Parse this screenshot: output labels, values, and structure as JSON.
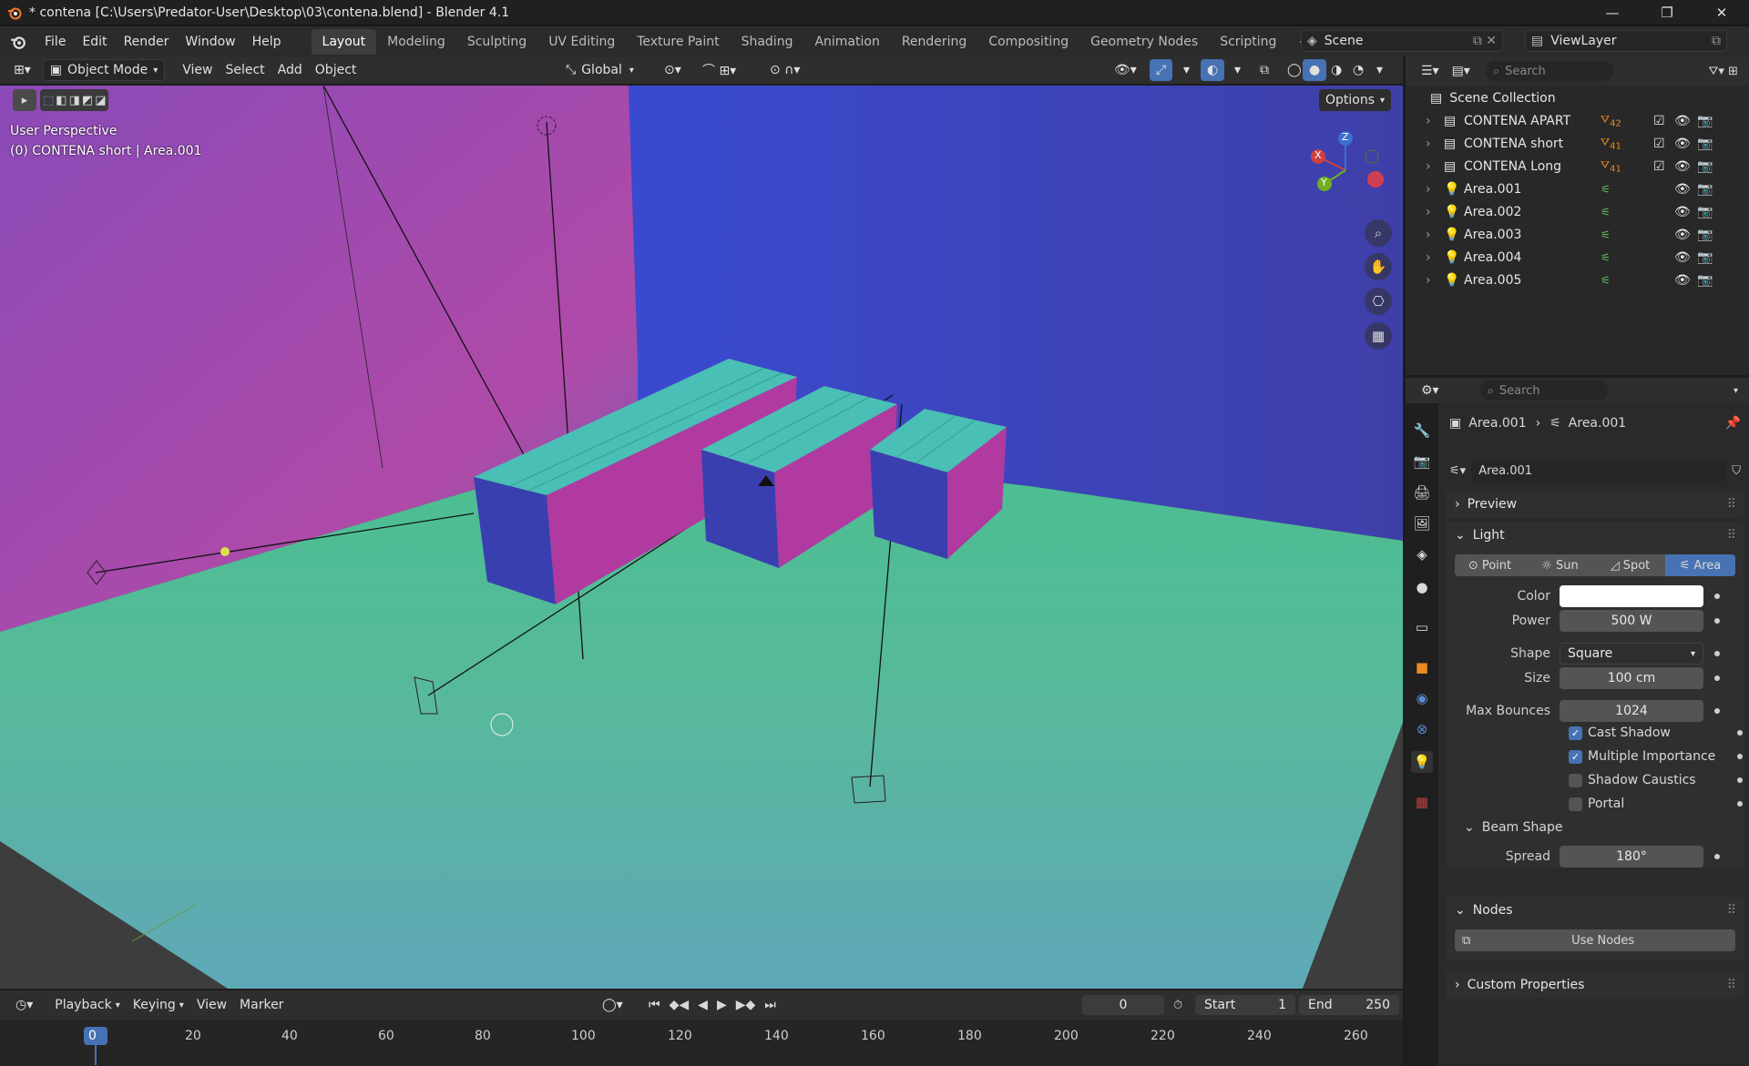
{
  "window": {
    "title": "* contena [C:\\Users\\Predator-User\\Desktop\\03\\contena.blend] - Blender 4.1",
    "minimize_glyph": "—",
    "maximize_glyph": "❐",
    "close_glyph": "✕"
  },
  "menu": [
    "File",
    "Edit",
    "Render",
    "Window",
    "Help"
  ],
  "workspaces": [
    "Layout",
    "Modeling",
    "Sculpting",
    "UV Editing",
    "Texture Paint",
    "Shading",
    "Animation",
    "Rendering",
    "Compositing",
    "Geometry Nodes",
    "Scripting"
  ],
  "scene": {
    "label": "Scene",
    "view_layer": "ViewLayer"
  },
  "viewport_header": {
    "mode": "Object Mode",
    "menus": [
      "View",
      "Select",
      "Add",
      "Object"
    ],
    "orientation": "Global",
    "options": "Options"
  },
  "viewport": {
    "perspective": "User Perspective",
    "active_object": "(0) CONTENA short | Area.001",
    "gizmo_axes": {
      "x": "X",
      "y": "Y",
      "z": "Z"
    }
  },
  "outliner": {
    "search_placeholder": "Search",
    "root": "Scene Collection",
    "items": [
      {
        "name": "CONTENA APART",
        "badge": "42",
        "type": "collection"
      },
      {
        "name": "CONTENA short",
        "badge": "41",
        "type": "collection"
      },
      {
        "name": "CONTENA Long",
        "badge": "41",
        "type": "collection"
      },
      {
        "name": "Area.001",
        "type": "light"
      },
      {
        "name": "Area.002",
        "type": "light"
      },
      {
        "name": "Area.003",
        "type": "light"
      },
      {
        "name": "Area.004",
        "type": "light"
      },
      {
        "name": "Area.005",
        "type": "light"
      }
    ]
  },
  "properties": {
    "search_placeholder": "Search",
    "breadcrumb": {
      "object": "Area.001",
      "data": "Area.001"
    },
    "datablock": "Area.001",
    "sections": {
      "preview": "Preview",
      "light": "Light",
      "beam_shape": "Beam Shape",
      "nodes": "Nodes",
      "custom_properties": "Custom Properties"
    },
    "light_types": [
      "Point",
      "Sun",
      "Spot",
      "Area"
    ],
    "active_light_type": "Area",
    "fields": {
      "color_label": "Color",
      "color_value": "#ffffff",
      "power_label": "Power",
      "power_value": "500 W",
      "shape_label": "Shape",
      "shape_value": "Square",
      "size_label": "Size",
      "size_value": "100 cm",
      "max_bounces_label": "Max Bounces",
      "max_bounces_value": "1024",
      "spread_label": "Spread",
      "spread_value": "180°"
    },
    "checkboxes": [
      {
        "label": "Cast Shadow",
        "checked": true
      },
      {
        "label": "Multiple Importance",
        "checked": true
      },
      {
        "label": "Shadow Caustics",
        "checked": false
      },
      {
        "label": "Portal",
        "checked": false
      }
    ],
    "use_nodes": "Use Nodes"
  },
  "timeline": {
    "menus": [
      "Playback",
      "Keying",
      "View",
      "Marker"
    ],
    "current_frame": "0",
    "start_label": "Start",
    "start_value": "1",
    "end_label": "End",
    "end_value": "250",
    "ruler": [
      "0",
      "20",
      "40",
      "60",
      "80",
      "100",
      "120",
      "140",
      "160",
      "180",
      "200",
      "220",
      "240",
      "260"
    ]
  },
  "colors": {
    "accent": "#4772b3",
    "active_tab": "#3d3d3d",
    "container_blue": "#3a3fb0",
    "container_magenta": "#b03aa0",
    "container_teal": "#4ab0a8"
  }
}
